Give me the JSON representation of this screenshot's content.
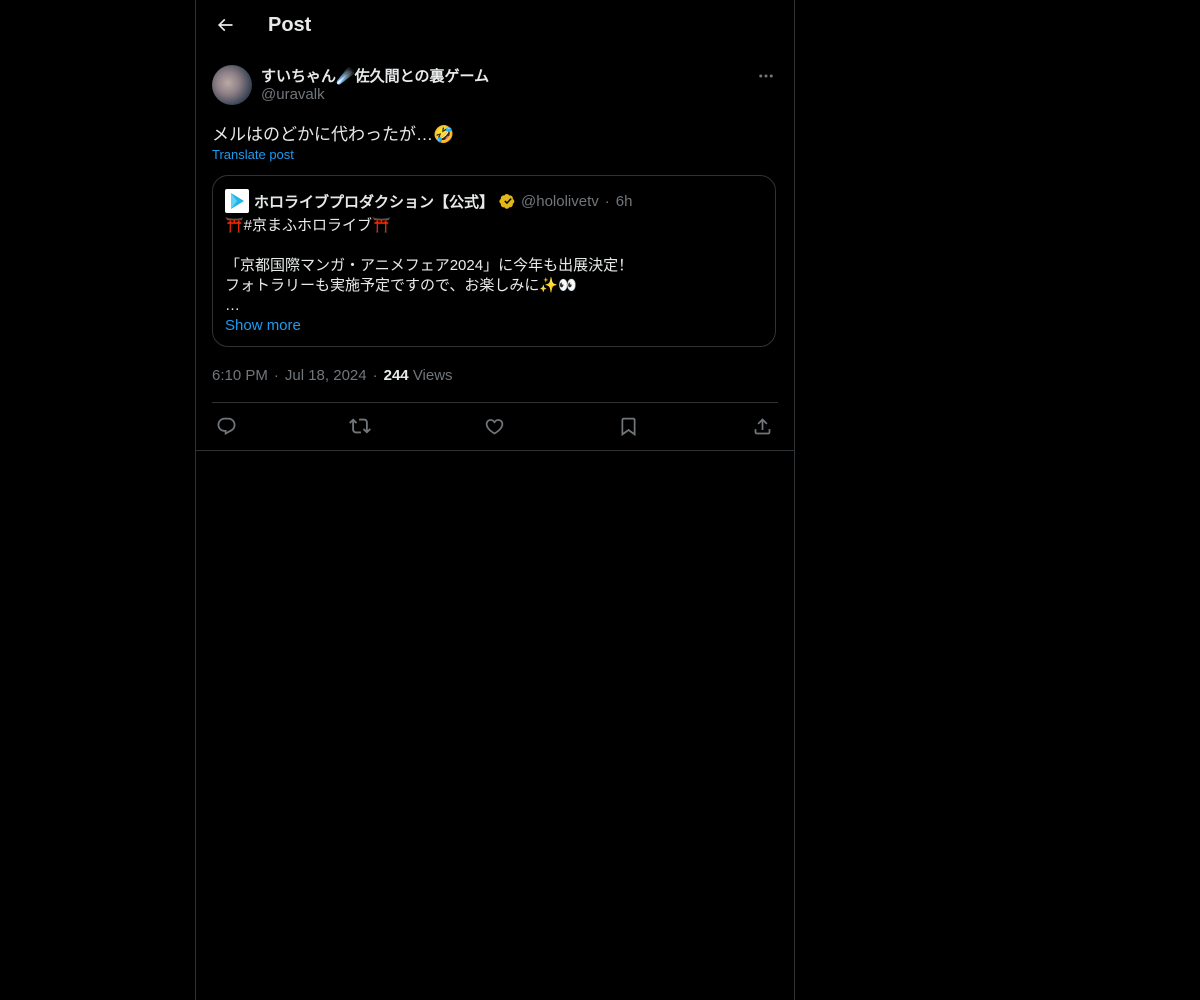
{
  "header": {
    "title": "Post",
    "back_icon": "arrow-left-icon"
  },
  "post": {
    "author": {
      "display_name": "すいちゃん☄️佐久間との裏ゲーム",
      "handle": "@uravalk"
    },
    "more_icon": "more-horizontal-icon",
    "text": "メルはのどかに代わったが…🤣",
    "translate_label": "Translate post",
    "quoted": {
      "name": "ホロライブプロダクション【公式】",
      "handle": "@hololivetv",
      "separator": "·",
      "time": "6h",
      "verified_icon": "gold-verified-badge-icon",
      "body": "⛩️#京まふホロライブ⛩️\n\n「京都国際マンガ・アニメフェア2024」に今年も出展決定！\nフォトラリーも実施予定ですので、お楽しみに✨👀\n…",
      "show_more_label": "Show more"
    },
    "meta": {
      "time": "6:10 PM",
      "separator": "·",
      "date": "Jul 18, 2024",
      "views_count": "244",
      "views_label": "Views"
    },
    "actions": [
      "reply-icon",
      "repost-icon",
      "like-icon",
      "bookmark-icon",
      "share-icon"
    ]
  },
  "colors": {
    "background": "#000000",
    "text": "#e7e9ea",
    "secondary_text": "#71767b",
    "accent": "#1d9bf0",
    "border": "#2f3336",
    "verified": "#e2b719"
  }
}
